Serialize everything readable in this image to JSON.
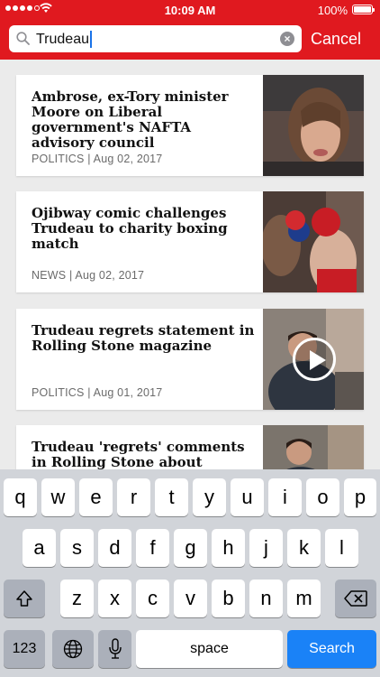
{
  "status_bar": {
    "time": "10:09 AM",
    "battery_percent": "100%",
    "signal_bars_filled": 4,
    "signal_bars_total": 5,
    "icons": [
      "signal-dots-icon",
      "wifi-icon",
      "battery-icon"
    ]
  },
  "search": {
    "query": "Trudeau",
    "cancel_label": "Cancel",
    "icons": [
      "search-icon",
      "clear-icon"
    ]
  },
  "articles": [
    {
      "headline": "Ambrose, ex-Tory minister Moore on Liberal government's NAFTA advisory council",
      "meta": "POLITICS | Aug 02, 2017",
      "has_video": false
    },
    {
      "headline": "Ojibway comic challenges Trudeau to charity boxing match",
      "meta": "NEWS | Aug 02, 2017",
      "has_video": false
    },
    {
      "headline": "Trudeau regrets statement in Rolling Stone magazine",
      "meta": "POLITICS | Aug 01, 2017",
      "has_video": true
    },
    {
      "headline": "Trudeau 'regrets' comments in Rolling Stone about Senator",
      "meta": "",
      "has_video": false
    }
  ],
  "keyboard": {
    "row1": [
      "q",
      "w",
      "e",
      "r",
      "t",
      "y",
      "u",
      "i",
      "o",
      "p"
    ],
    "row2": [
      "a",
      "s",
      "d",
      "f",
      "g",
      "h",
      "j",
      "k",
      "l"
    ],
    "row3": [
      "z",
      "x",
      "c",
      "v",
      "b",
      "n",
      "m"
    ],
    "numbers_label": "123",
    "space_label": "space",
    "search_label": "Search",
    "icons": [
      "shift-icon",
      "backspace-icon",
      "globe-icon",
      "microphone-icon"
    ]
  },
  "colors": {
    "brand_red": "#e0191f",
    "search_key_blue": "#1a82f7"
  }
}
